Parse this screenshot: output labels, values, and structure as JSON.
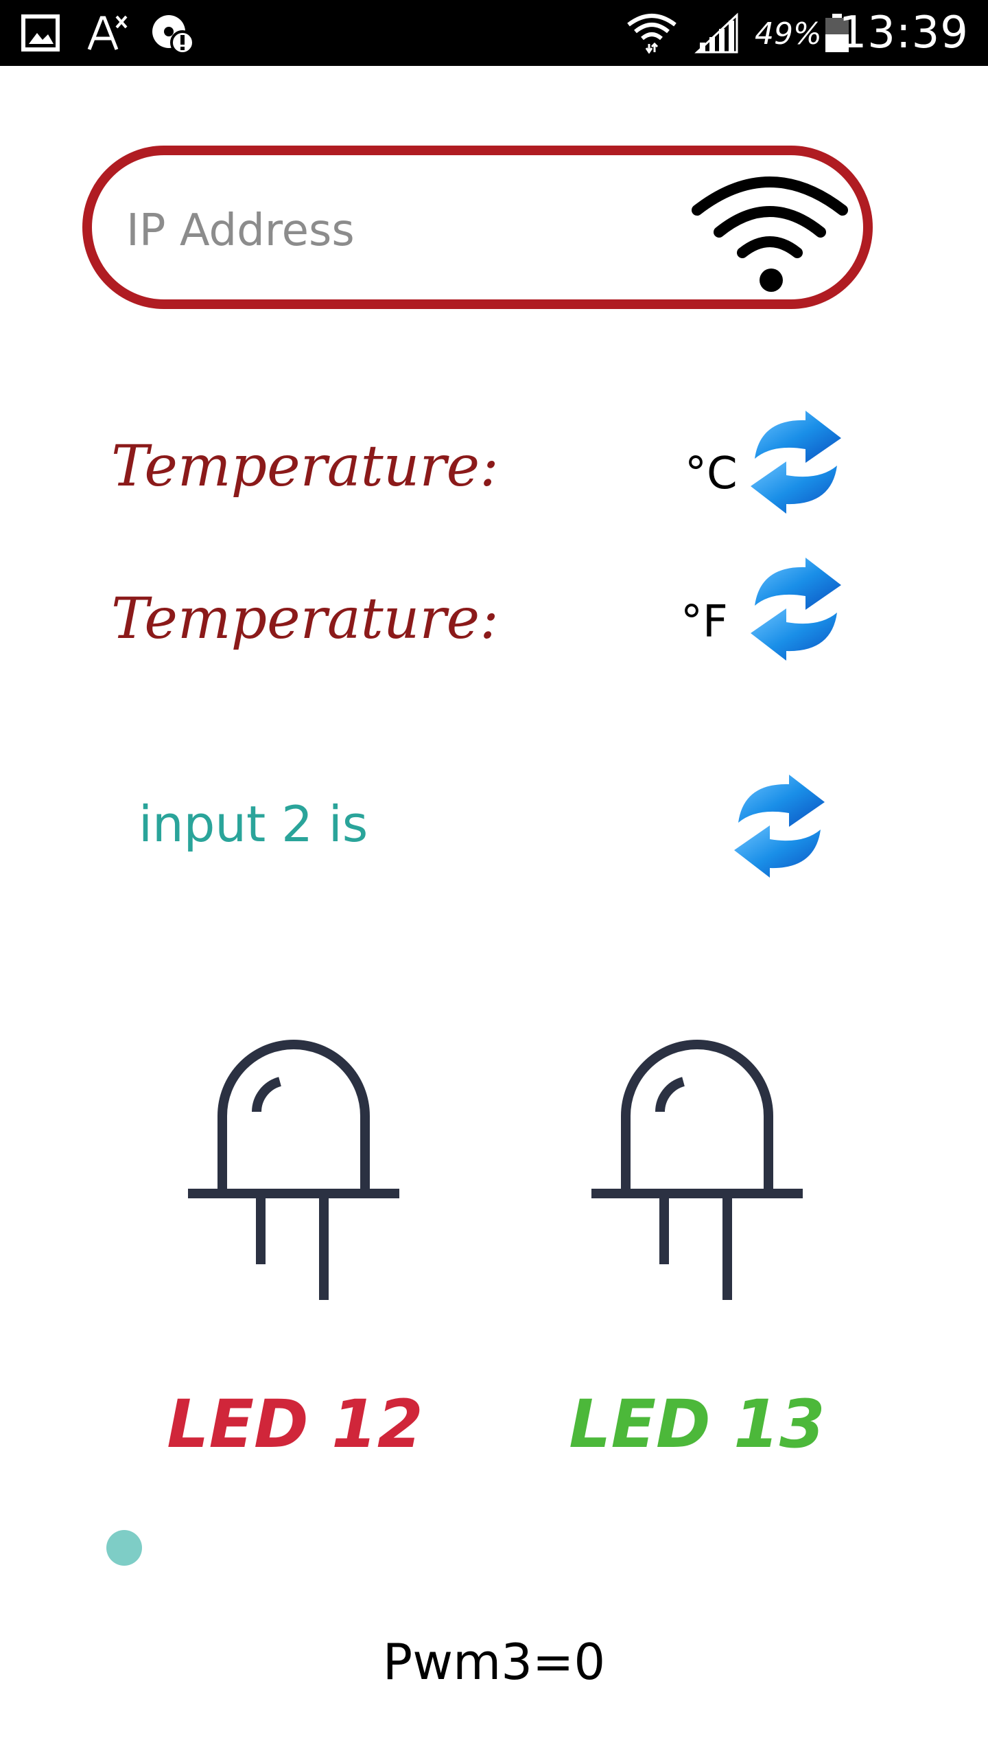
{
  "status_bar": {
    "time": "13:39",
    "battery_percent": "49%",
    "icons": [
      "gallery-icon",
      "font-icon",
      "storage-warning-icon",
      "wifi-icon",
      "signal-icon",
      "battery-icon"
    ]
  },
  "connection": {
    "ip_placeholder": "IP Address",
    "ip_value": "",
    "connect_icon": "wifi-icon",
    "border_color": "#b01c22"
  },
  "temperature_celsius": {
    "label": "Temperature:",
    "value": "",
    "unit": "°C",
    "refresh_icon": "refresh-icon"
  },
  "temperature_fahrenheit": {
    "label": "Temperature:",
    "value": "",
    "unit": "°F",
    "refresh_icon": "refresh-icon"
  },
  "input2": {
    "label": "input 2 is",
    "value": "",
    "refresh_icon": "refresh-icon"
  },
  "leds": [
    {
      "label": "LED 12",
      "color": "#d0263a",
      "icon": "led-icon"
    },
    {
      "label": "LED 13",
      "color": "#4cb83a",
      "icon": "led-icon"
    }
  ],
  "pwm": {
    "label": "Pwm3=0",
    "slider_value": 0,
    "thumb_color": "#7ecdc6"
  },
  "colors": {
    "temperature_label": "#8b1a1a",
    "input_label": "#2aa49a",
    "led_outline": "#2b3142"
  }
}
